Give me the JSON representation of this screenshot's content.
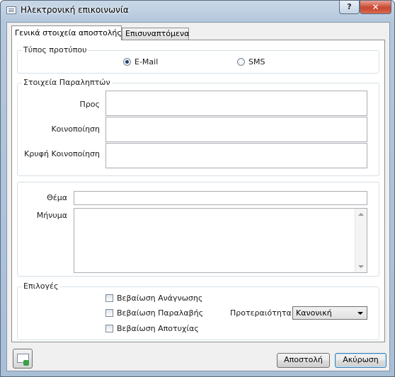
{
  "window": {
    "title": "Ηλεκτρονική επικοινωνία",
    "help_label": "?",
    "close_label": "✕"
  },
  "tabs": [
    {
      "label": "Γενικά στοιχεία αποστολής",
      "active": true
    },
    {
      "label": "Επισυναπτόμενα",
      "active": false
    }
  ],
  "template_type": {
    "title": "Τύπος προτύπου",
    "options": [
      {
        "label": "E-Mail",
        "selected": true
      },
      {
        "label": "SMS",
        "selected": false
      }
    ]
  },
  "recipients": {
    "title": "Στοιχεία Παραληπτών",
    "to_label": "Προς",
    "to_value": "",
    "cc_label": "Κοινοποίηση",
    "cc_value": "",
    "bcc_label": "Κρυφή Κοινοποίηση",
    "bcc_value": ""
  },
  "message": {
    "subject_label": "Θέμα",
    "subject_value": "",
    "body_label": "Μήνυμα",
    "body_value": ""
  },
  "options": {
    "title": "Επιλογές",
    "checkboxes": [
      {
        "label": "Βεβαίωση Ανάγνωσης",
        "checked": false
      },
      {
        "label": "Βεβαίωση Παραλαβής",
        "checked": false
      },
      {
        "label": "Βεβαίωση Αποτυχίας",
        "checked": false
      }
    ],
    "priority_label": "Προτεραιότητα",
    "priority_value": "Κανονική"
  },
  "footer": {
    "send_label": "Αποστολή",
    "cancel_label": "Ακύρωση",
    "icon": "email-attachment-icon"
  }
}
